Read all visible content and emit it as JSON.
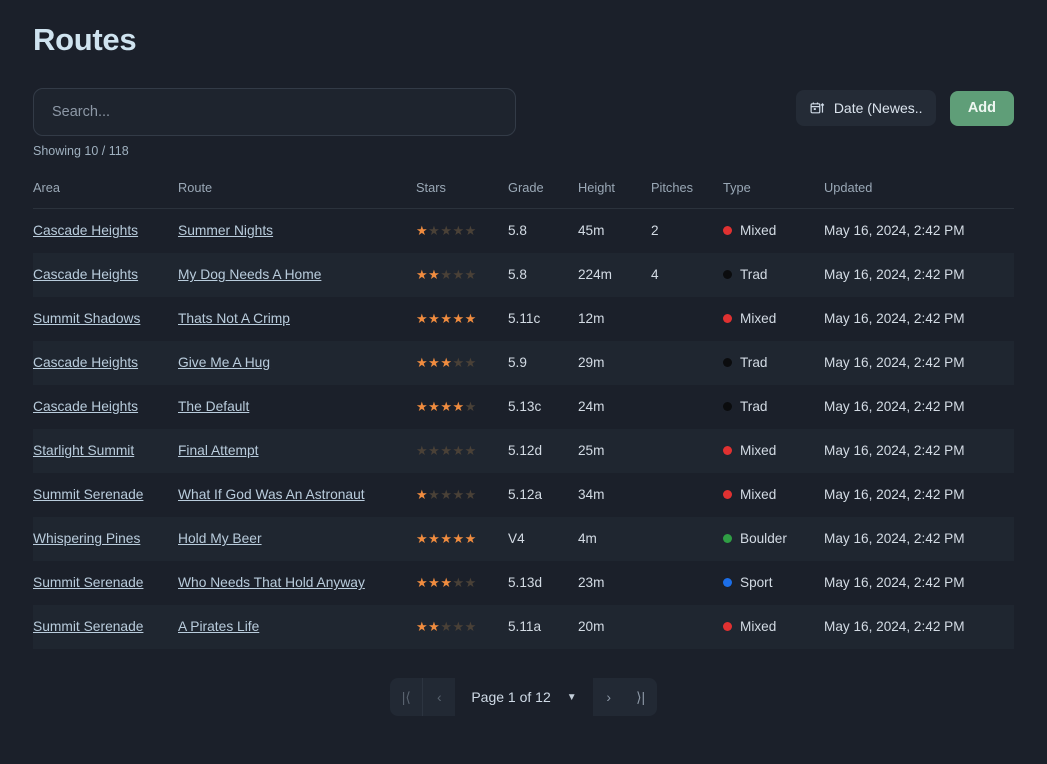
{
  "header": {
    "title": "Routes"
  },
  "search": {
    "value": "",
    "placeholder": "Search..."
  },
  "toolbar": {
    "sort_label": "Date (Newes...",
    "sort_icon": "calendar-ascending-icon",
    "add_label": "Add"
  },
  "status": {
    "showing": "Showing 10 / 118"
  },
  "table": {
    "columns": [
      "Area",
      "Route",
      "Stars",
      "Grade",
      "Height",
      "Pitches",
      "Type",
      "Updated"
    ],
    "max_stars": 5,
    "type_colors": {
      "Mixed": "#e03131",
      "Trad": "#0b0c0e",
      "Boulder": "#2f9e44",
      "Sport": "#1c6ee8"
    },
    "rows": [
      {
        "area": "Cascade Heights",
        "route": "Summer Nights",
        "stars": 1,
        "grade": "5.8",
        "height": "45m",
        "pitches": "2",
        "type": "Mixed",
        "updated": "May 16, 2024, 2:42 PM"
      },
      {
        "area": "Cascade Heights",
        "route": "My Dog Needs A Home",
        "stars": 2,
        "grade": "5.8",
        "height": "224m",
        "pitches": "4",
        "type": "Trad",
        "updated": "May 16, 2024, 2:42 PM"
      },
      {
        "area": "Summit Shadows",
        "route": "Thats Not A Crimp",
        "stars": 5,
        "grade": "5.11c",
        "height": "12m",
        "pitches": "",
        "type": "Mixed",
        "updated": "May 16, 2024, 2:42 PM"
      },
      {
        "area": "Cascade Heights",
        "route": "Give Me A Hug",
        "stars": 3,
        "grade": "5.9",
        "height": "29m",
        "pitches": "",
        "type": "Trad",
        "updated": "May 16, 2024, 2:42 PM"
      },
      {
        "area": "Cascade Heights",
        "route": "The Default",
        "stars": 4,
        "grade": "5.13c",
        "height": "24m",
        "pitches": "",
        "type": "Trad",
        "updated": "May 16, 2024, 2:42 PM"
      },
      {
        "area": "Starlight Summit",
        "route": "Final Attempt",
        "stars": 0,
        "grade": "5.12d",
        "height": "25m",
        "pitches": "",
        "type": "Mixed",
        "updated": "May 16, 2024, 2:42 PM"
      },
      {
        "area": "Summit Serenade",
        "route": "What If God Was An Astronaut",
        "stars": 1,
        "grade": "5.12a",
        "height": "34m",
        "pitches": "",
        "type": "Mixed",
        "updated": "May 16, 2024, 2:42 PM"
      },
      {
        "area": "Whispering Pines",
        "route": "Hold My Beer",
        "stars": 5,
        "grade": "V4",
        "height": "4m",
        "pitches": "",
        "type": "Boulder",
        "updated": "May 16, 2024, 2:42 PM"
      },
      {
        "area": "Summit Serenade",
        "route": "Who Needs That Hold Anyway",
        "stars": 3,
        "grade": "5.13d",
        "height": "23m",
        "pitches": "",
        "type": "Sport",
        "updated": "May 16, 2024, 2:42 PM"
      },
      {
        "area": "Summit Serenade",
        "route": "A Pirates Life",
        "stars": 2,
        "grade": "5.11a",
        "height": "20m",
        "pitches": "",
        "type": "Mixed",
        "updated": "May 16, 2024, 2:42 PM"
      }
    ]
  },
  "pagination": {
    "first_label": "|⟨",
    "prev_label": "‹",
    "page_label": "Page 1 of 12",
    "next_label": "›",
    "last_label": "⟩|",
    "current_page": 1,
    "total_pages": 12
  }
}
